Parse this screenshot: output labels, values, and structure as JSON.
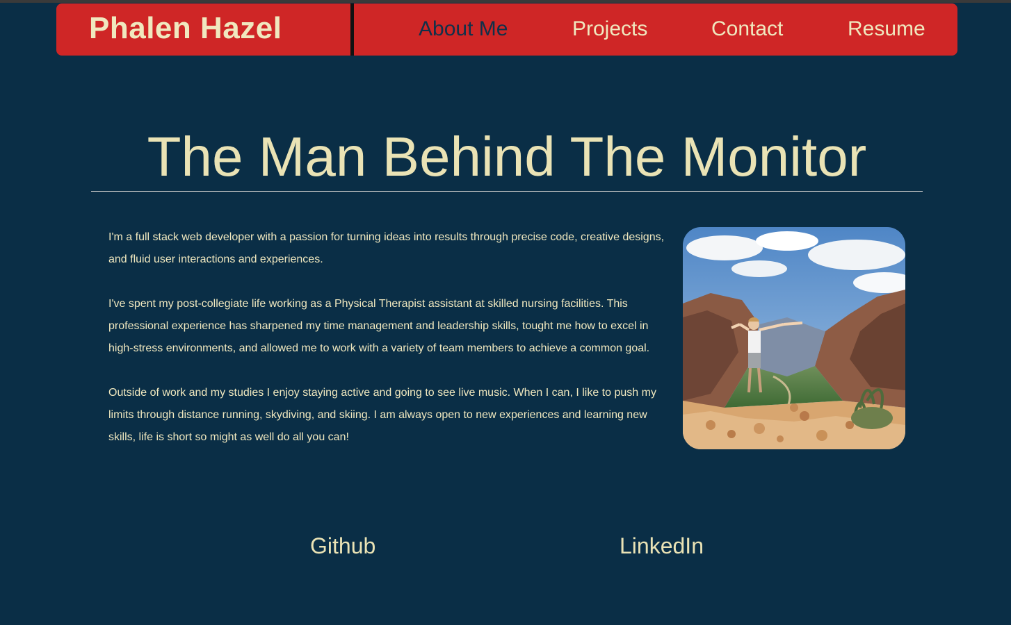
{
  "header": {
    "brand": "Phalen Hazel",
    "nav": [
      {
        "label": "About Me",
        "active": true
      },
      {
        "label": "Projects",
        "active": false
      },
      {
        "label": "Contact",
        "active": false
      },
      {
        "label": "Resume",
        "active": false
      }
    ]
  },
  "main": {
    "title": "The Man Behind The Monitor",
    "paragraphs": [
      "I'm a full stack web developer with a passion for turning ideas into results through precise code, creative designs, and fluid user interactions and experiences.",
      "I've spent my post-collegiate life working as a Physical Therapist assistant at skilled nursing facilities. This professional experience has sharpened my time management and leadership skills, tought me how to excel in high-stress environments, and allowed me to work with a variety of team members to achieve a common goal.",
      "Outside of work and my studies I enjoy staying active and going to see live music. When I can, I like to push my limits through distance running, skydiving, and skiing. I am always open to new experiences and learning new skills, life is short so might as well do all you can!"
    ]
  },
  "footer": {
    "links": [
      {
        "label": "Github"
      },
      {
        "label": "LinkedIn"
      }
    ]
  },
  "colors": {
    "background": "#0a2e46",
    "navbar": "#cf2626",
    "text_cream": "#f0e8bf",
    "active_nav": "#10304a"
  }
}
